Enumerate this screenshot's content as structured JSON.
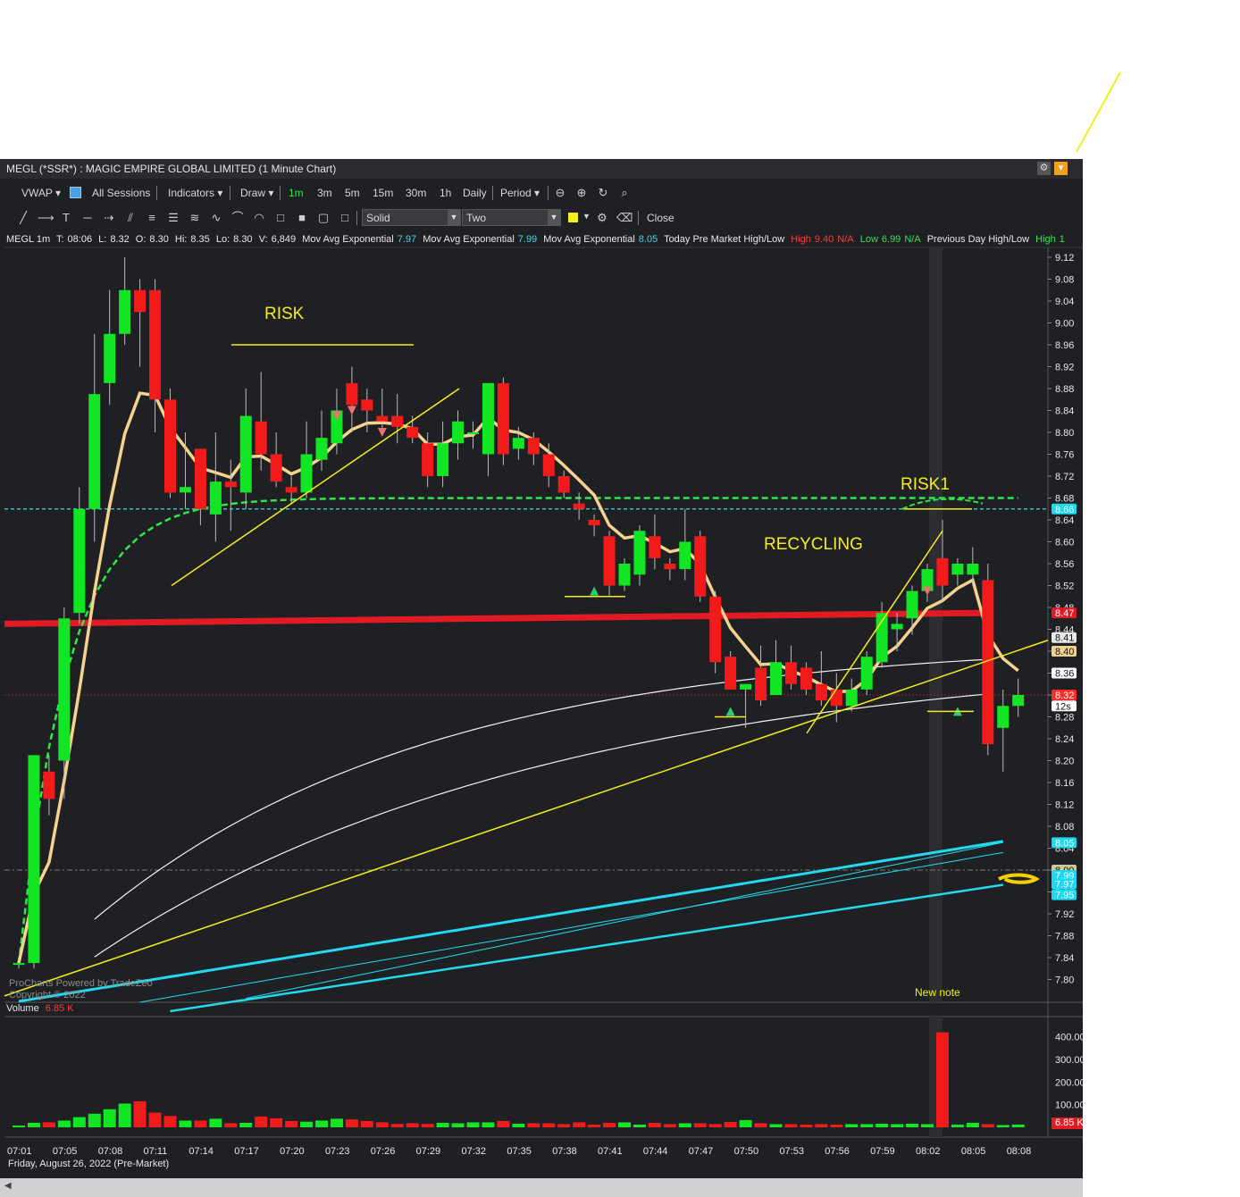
{
  "window": {
    "title": "MEGL (*SSR*) : MAGIC EMPIRE GLOBAL LIMITED (1 Minute Chart)"
  },
  "toolbar1": {
    "vwap": "VWAP ▾",
    "all_sessions": "All Sessions",
    "indicators": "Indicators ▾",
    "draw": "Draw ▾",
    "intervals": [
      "1m",
      "3m",
      "5m",
      "15m",
      "30m",
      "1h",
      "Daily"
    ],
    "period": "Period ▾",
    "active_interval": "1m"
  },
  "toolbar2": {
    "line_style": "Solid",
    "line_width": "Two",
    "close": "Close"
  },
  "infobar": {
    "symbol": "MEGL 1m",
    "time_label": "T:",
    "time_val": "08:06",
    "low_label": "L:",
    "low_val": "8.32",
    "open_label": "O:",
    "open_val": "8.30",
    "hi_label": "Hi:",
    "hi_val": "8.35",
    "lo_label": "Lo:",
    "lo_val": "8.30",
    "vol_label": "V:",
    "vol_val": "6,849",
    "ema1_label": "Mov Avg Exponential",
    "ema1_val": "7.97",
    "ema2_label": "Mov Avg Exponential",
    "ema2_val": "7.99",
    "ema3_label": "Mov Avg Exponential",
    "ema3_val": "8.05",
    "pm_label": "Today Pre Market High/Low",
    "pm_high_label": "High",
    "pm_high_val": "9.40",
    "pm_high_na": "N/A",
    "pm_low_label": "Low",
    "pm_low_val": "6.99",
    "pm_low_na": "N/A",
    "prev_label": "Previous Day High/Low",
    "prev_high_label": "High",
    "prev_high_val": "1"
  },
  "annotations": {
    "risk": "RISK",
    "risk1": "RISK1",
    "recycling": "RECYCLING",
    "new_note": "New note"
  },
  "watermark": [
    "ProCharts Powered by TradeZéo",
    "Copyright © 2022"
  ],
  "volume_panel": {
    "label": "Volume",
    "value": "6.85 K"
  },
  "date_label": "Friday, August 26, 2022 (Pre-Market)",
  "chart_data": {
    "type": "candlestick",
    "y_ticks": [
      "9.12",
      "9.08",
      "9.04",
      "9.00",
      "8.96",
      "8.92",
      "8.88",
      "8.84",
      "8.80",
      "8.76",
      "8.72",
      "8.68",
      "8.64",
      "8.60",
      "8.56",
      "8.52",
      "8.48",
      "8.44",
      "8.40",
      "8.36",
      "8.32",
      "8.28",
      "8.24",
      "8.20",
      "8.16",
      "8.12",
      "8.08",
      "8.04",
      "8.00",
      "7.96",
      "7.92",
      "7.88",
      "7.84",
      "7.80"
    ],
    "ylim": [
      7.78,
      9.14
    ],
    "x_ticks": [
      "07:01",
      "07:05",
      "07:08",
      "07:11",
      "07:14",
      "07:17",
      "07:20",
      "07:23",
      "07:26",
      "07:29",
      "07:32",
      "07:35",
      "07:38",
      "07:41",
      "07:44",
      "07:47",
      "07:50",
      "07:53",
      "07:56",
      "07:59",
      "08:02",
      "08:05",
      "08:08"
    ],
    "candles": [
      [
        7.83,
        7.83,
        7.82,
        7.83
      ],
      [
        7.83,
        8.21,
        7.82,
        8.21
      ],
      [
        8.18,
        8.13,
        8.1,
        8.21
      ],
      [
        8.2,
        8.46,
        8.13,
        8.48
      ],
      [
        8.47,
        8.66,
        8.45,
        8.7
      ],
      [
        8.66,
        8.87,
        8.6,
        8.98
      ],
      [
        8.89,
        8.98,
        8.85,
        9.06
      ],
      [
        8.98,
        9.06,
        8.96,
        9.12
      ],
      [
        9.06,
        9.02,
        8.92,
        9.08
      ],
      [
        9.06,
        8.86,
        8.8,
        9.08
      ],
      [
        8.86,
        8.69,
        8.68,
        8.88
      ],
      [
        8.69,
        8.7,
        8.66,
        8.8
      ],
      [
        8.77,
        8.66,
        8.63,
        8.77
      ],
      [
        8.65,
        8.71,
        8.6,
        8.8
      ],
      [
        8.71,
        8.7,
        8.62,
        8.75
      ],
      [
        8.69,
        8.83,
        8.66,
        8.88
      ],
      [
        8.82,
        8.76,
        8.73,
        8.91
      ],
      [
        8.76,
        8.71,
        8.7,
        8.8
      ],
      [
        8.7,
        8.69,
        8.67,
        8.72
      ],
      [
        8.69,
        8.76,
        8.68,
        8.82
      ],
      [
        8.75,
        8.79,
        8.73,
        8.84
      ],
      [
        8.78,
        8.84,
        8.76,
        8.88
      ],
      [
        8.89,
        8.85,
        8.8,
        8.92
      ],
      [
        8.86,
        8.84,
        8.8,
        8.88
      ],
      [
        8.83,
        8.82,
        8.8,
        8.88
      ],
      [
        8.83,
        8.81,
        8.78,
        8.87
      ],
      [
        8.81,
        8.79,
        8.78,
        8.83
      ],
      [
        8.78,
        8.72,
        8.7,
        8.8
      ],
      [
        8.72,
        8.78,
        8.7,
        8.82
      ],
      [
        8.78,
        8.82,
        8.75,
        8.84
      ],
      [
        8.8,
        8.8,
        8.77,
        8.82
      ],
      [
        8.76,
        8.89,
        8.72,
        8.89
      ],
      [
        8.89,
        8.76,
        8.74,
        8.9
      ],
      [
        8.77,
        8.79,
        8.75,
        8.81
      ],
      [
        8.79,
        8.76,
        8.74,
        8.8
      ],
      [
        8.76,
        8.72,
        8.7,
        8.78
      ],
      [
        8.72,
        8.69,
        8.68,
        8.73
      ],
      [
        8.67,
        8.66,
        8.64,
        8.69
      ],
      [
        8.64,
        8.63,
        8.61,
        8.65
      ],
      [
        8.61,
        8.52,
        8.5,
        8.62
      ],
      [
        8.52,
        8.56,
        8.51,
        8.57
      ],
      [
        8.54,
        8.62,
        8.52,
        8.63
      ],
      [
        8.61,
        8.57,
        8.55,
        8.65
      ],
      [
        8.56,
        8.55,
        8.53,
        8.57
      ],
      [
        8.55,
        8.6,
        8.53,
        8.66
      ],
      [
        8.61,
        8.5,
        8.49,
        8.62
      ],
      [
        8.5,
        8.38,
        8.36,
        8.51
      ],
      [
        8.39,
        8.33,
        8.33,
        8.4
      ],
      [
        8.33,
        8.34,
        8.26,
        8.34
      ],
      [
        8.37,
        8.31,
        8.3,
        8.41
      ],
      [
        8.32,
        8.38,
        8.32,
        8.42
      ],
      [
        8.38,
        8.34,
        8.33,
        8.41
      ],
      [
        8.37,
        8.33,
        8.32,
        8.38
      ],
      [
        8.34,
        8.31,
        8.3,
        8.4
      ],
      [
        8.33,
        8.3,
        8.27,
        8.36
      ],
      [
        8.3,
        8.33,
        8.29,
        8.35
      ],
      [
        8.33,
        8.39,
        8.32,
        8.4
      ],
      [
        8.38,
        8.47,
        8.37,
        8.49
      ],
      [
        8.44,
        8.45,
        8.4,
        8.47
      ],
      [
        8.46,
        8.51,
        8.43,
        8.52
      ],
      [
        8.51,
        8.55,
        8.49,
        8.56
      ],
      [
        8.57,
        8.52,
        8.49,
        8.64
      ],
      [
        8.54,
        8.56,
        8.52,
        8.57
      ],
      [
        8.54,
        8.56,
        8.52,
        8.59
      ],
      [
        8.53,
        8.23,
        8.21,
        8.56
      ],
      [
        8.26,
        8.3,
        8.18,
        8.33
      ],
      [
        8.3,
        8.32,
        8.28,
        8.35
      ]
    ],
    "volume_ticks": [
      "400.00",
      "300.00",
      "200.00",
      "100.00"
    ],
    "volume_max": 450,
    "volume": [
      8,
      20,
      22,
      30,
      45,
      60,
      80,
      105,
      115,
      65,
      50,
      30,
      30,
      38,
      18,
      20,
      48,
      40,
      28,
      25,
      30,
      38,
      35,
      28,
      22,
      15,
      18,
      15,
      20,
      18,
      22,
      22,
      28,
      16,
      18,
      18,
      14,
      22,
      12,
      20,
      22,
      12,
      20,
      14,
      18,
      18,
      14,
      24,
      32,
      18,
      14,
      14,
      12,
      14,
      12,
      14,
      14,
      16,
      14,
      16,
      14,
      420,
      12,
      20,
      14,
      10,
      12
    ],
    "price_labels": [
      {
        "value": "8.66",
        "color": "#1ed7f0"
      },
      {
        "value": "8.47",
        "color": "#e21a24"
      },
      {
        "value": "8.41",
        "color": "#e8e8e8"
      },
      {
        "value": "8.40",
        "color": "#f0d290"
      },
      {
        "value": "8.36",
        "color": "#ffffff"
      },
      {
        "value": "8.32",
        "color": "#ff2a2a"
      },
      {
        "value": "12s",
        "color": "#ffffff"
      },
      {
        "value": "8.05",
        "color": "#1ed7f0"
      },
      {
        "value": "8.00",
        "color": "#cccc99"
      },
      {
        "value": "7.99",
        "color": "#1ed7f0"
      },
      {
        "value": "7.97",
        "color": "#1ed7f0"
      },
      {
        "value": "7.95",
        "color": "#1ed7f0"
      }
    ],
    "current_volume_label": "6.85 K",
    "colors": {
      "up": "#11e524",
      "down": "#f21b1b",
      "background": "#1f2023",
      "ema_fast": "#f5d38f",
      "vwap_band": "#e21a24",
      "avg": "#22d9ef",
      "trendline": "#f5ee1c"
    }
  }
}
